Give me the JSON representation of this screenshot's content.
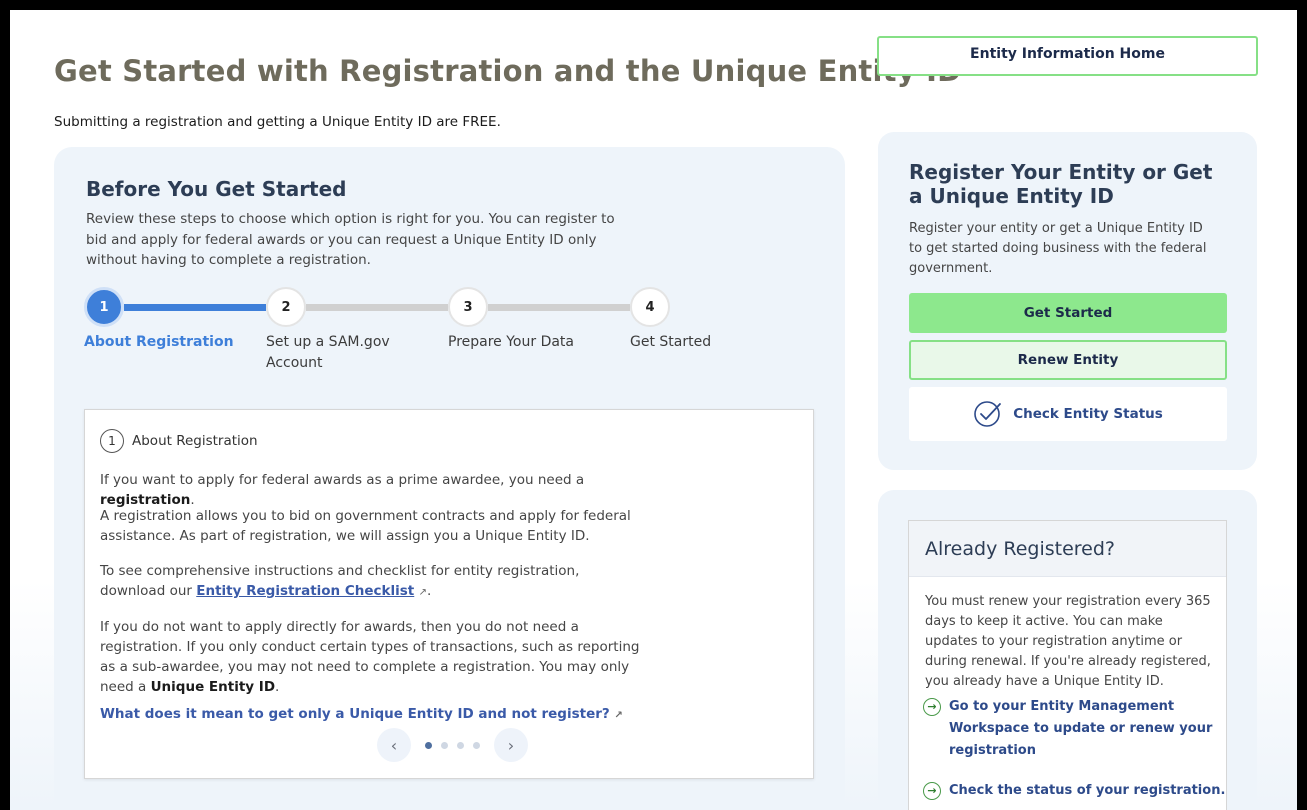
{
  "header": {
    "title": "Get Started with Registration and the Unique Entity ID",
    "subtitle": "Submitting a registration and getting a Unique Entity ID are FREE.",
    "entity_home_label": "Entity Information Home"
  },
  "before": {
    "title": "Before You Get Started",
    "description": "Review these steps to choose which option is right for you. You can register to bid and apply for federal awards or you can request a Unique Entity ID only without having to complete a registration.",
    "steps": [
      {
        "num": "1",
        "label": "About Registration"
      },
      {
        "num": "2",
        "label": "Set up a SAM.gov Account"
      },
      {
        "num": "3",
        "label": "Prepare Your Data"
      },
      {
        "num": "4",
        "label": "Get Started"
      }
    ],
    "active_step": 1
  },
  "info": {
    "num": "1",
    "heading": "About Registration",
    "p1_pre": "If you want to apply for federal awards as a prime awardee, you need a ",
    "p1_bold": "registration",
    "p1_post": ".",
    "p2": "A registration allows you to bid on government contracts and apply for federal assistance. As part of registration, we will assign you a Unique Entity ID.",
    "p3_pre": "To see comprehensive instructions and checklist for entity registration, download our ",
    "p3_link": "Entity Registration Checklist",
    "p3_post": ".",
    "p4_pre": "If you do not want to apply directly for awards, then you do not need a registration. If you only conduct certain types of transactions, such as reporting as a sub-awardee, you may not need to complete a registration. You may only need a ",
    "p4_bold": "Unique Entity ID",
    "p4_post": ".",
    "question": "What does it mean to get only a Unique Entity ID and not register?",
    "carousel": {
      "prev": "‹",
      "next": "›",
      "dots": 4,
      "active": 1
    }
  },
  "register": {
    "title": "Register Your Entity or Get a Unique Entity ID",
    "description": "Register your entity or get a Unique Entity ID to get started doing business with the federal government.",
    "get_started": "Get Started",
    "renew": "Renew Entity",
    "check_status": "Check Entity Status"
  },
  "already": {
    "title": "Already Registered?",
    "description": "You must renew your registration every 365 days to keep it active. You can make updates to your registration anytime or during renewal. If you're already registered, you already have a Unique Entity ID.",
    "link1": "Go to your Entity Management Workspace to update or renew your registration",
    "link2": "Check the status of your registration."
  },
  "colors": {
    "title": "#6e6b5c",
    "accent_blue": "#3e7fd9",
    "green": "#8de88d",
    "card_bg": "#eef4fa",
    "link": "#3a5aa8"
  }
}
